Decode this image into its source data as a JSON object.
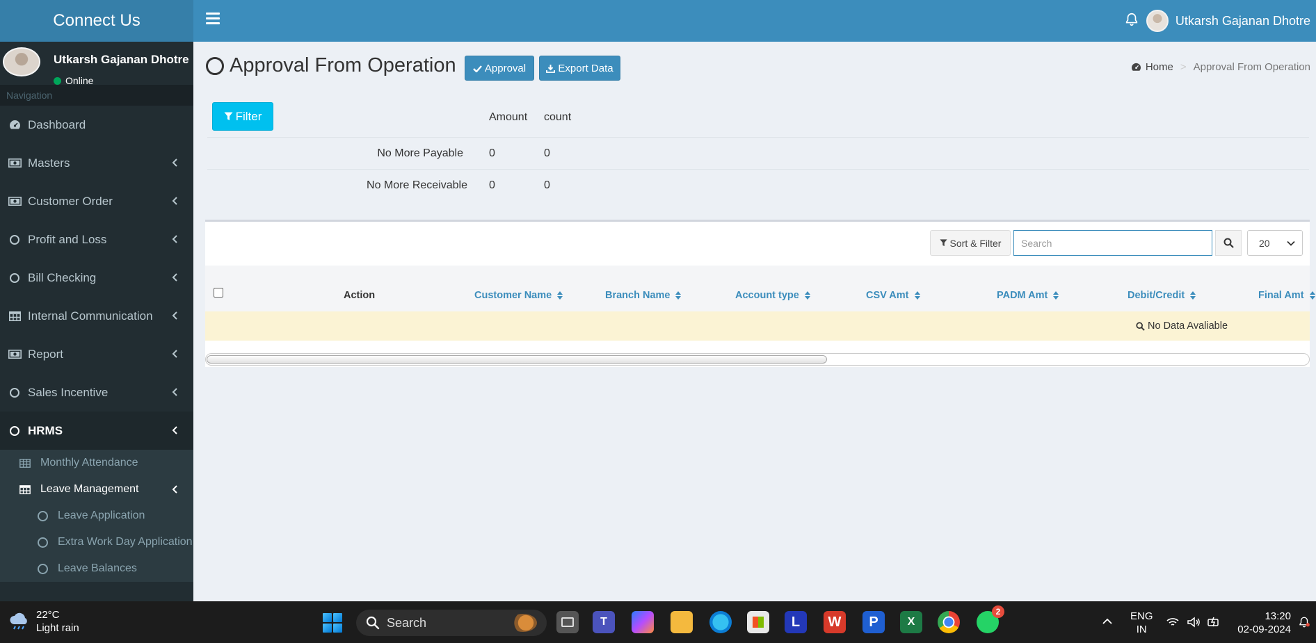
{
  "app": {
    "title": "Connect Us"
  },
  "header": {
    "user_name": "Utkarsh Gajanan Dhotre"
  },
  "sidebar": {
    "user_name": "Utkarsh Gajanan Dhotre",
    "status": "Online",
    "nav_header": "Navigation",
    "items": [
      {
        "label": "Dashboard"
      },
      {
        "label": "Masters"
      },
      {
        "label": "Customer Order"
      },
      {
        "label": "Profit and Loss"
      },
      {
        "label": "Bill Checking"
      },
      {
        "label": "Internal Communication"
      },
      {
        "label": "Report"
      },
      {
        "label": "Sales Incentive"
      },
      {
        "label": "HRMS"
      }
    ],
    "hrms_sub": [
      {
        "label": "Monthly Attendance"
      },
      {
        "label": "Leave Management"
      }
    ],
    "leave_sub": [
      {
        "label": "Leave Application"
      },
      {
        "label": "Extra Work Day Application"
      },
      {
        "label": "Leave Balances"
      }
    ]
  },
  "page": {
    "title": "Approval From Operation",
    "approval_button": "Approval",
    "export_button": "Export Data",
    "breadcrumb_home": "Home",
    "breadcrumb_sep": ">",
    "breadcrumb_current": "Approval From Operation",
    "filter_button": "Filter"
  },
  "summary": {
    "col_amount": "Amount",
    "col_count": "count",
    "rows": [
      {
        "label": "No More Payable",
        "amount": "0",
        "count": "0"
      },
      {
        "label": "No More Receivable",
        "amount": "0",
        "count": "0"
      }
    ]
  },
  "table": {
    "sort_filter_button": "Sort & Filter",
    "search_placeholder": "Search",
    "page_size": "20",
    "columns": [
      "Action",
      "Customer Name",
      "Branch Name",
      "Account type",
      "CSV Amt",
      "PADM Amt",
      "Debit/Credit",
      "Final Amt"
    ],
    "empty_message": "No Data Avaliable"
  },
  "taskbar": {
    "temperature": "22°C",
    "weather": "Light rain",
    "search_label": "Search",
    "lang_1": "ENG",
    "lang_2": "IN",
    "time": "13:20",
    "date": "02-09-2024",
    "whatsapp_badge": "2"
  },
  "colors": {
    "header": "#3c8dbc",
    "logo": "#367fa9",
    "sidebar": "#222d32",
    "filter": "#00c0ef",
    "empty_row": "#fbf3d4"
  }
}
